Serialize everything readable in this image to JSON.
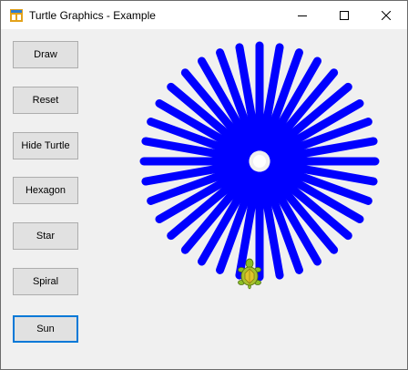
{
  "window": {
    "title": "Turtle Graphics - Example"
  },
  "buttons": {
    "draw": "Draw",
    "reset": "Reset",
    "hide_turtle": "Hide Turtle",
    "hexagon": "Hexagon",
    "star": "Star",
    "spiral": "Spiral",
    "sun": "Sun"
  },
  "canvas": {
    "pattern": "sun",
    "ray_count": 36,
    "line_color": "#0000ff",
    "turtle_icon": "turtle-icon"
  },
  "colors": {
    "focus_border": "#0078d7",
    "pen": "#0000ff"
  }
}
